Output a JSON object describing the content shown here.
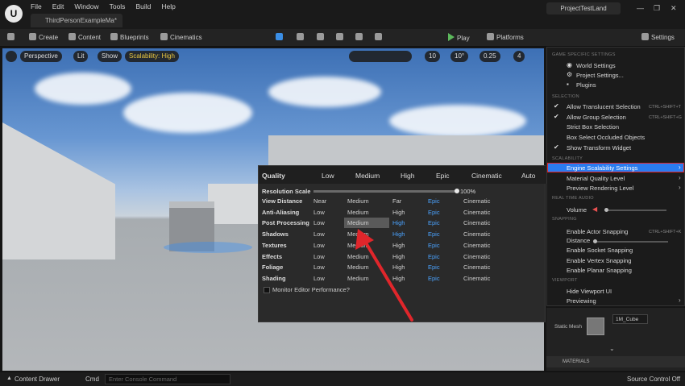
{
  "app": {
    "menus": [
      "File",
      "Edit",
      "Window",
      "Tools",
      "Build",
      "Help"
    ],
    "document_tab": "ThirdPersonExampleMa*",
    "project_name": "ProjectTestLand",
    "window_controls": [
      "—",
      "❐",
      "✕"
    ]
  },
  "toolbar": {
    "create": "Create",
    "content": "Content",
    "blueprints": "Blueprints",
    "cinematics": "Cinematics",
    "play": "Play",
    "platforms": "Platforms",
    "settings": "Settings"
  },
  "viewport": {
    "perspective": "Perspective",
    "lit": "Lit",
    "show": "Show",
    "scalability": "Scalability: High",
    "grid_size": "10",
    "rotation_snap": "10°",
    "scale_snap": "0.25",
    "camera_speed": "4"
  },
  "scalability_panel": {
    "quality_label": "Quality",
    "levels": [
      "Low",
      "Medium",
      "High",
      "Epic",
      "Cinematic",
      "Auto"
    ],
    "resolution_label": "Resolution Scale",
    "resolution_value": "100%",
    "resolution_fraction": 1.0,
    "rows": [
      {
        "label": "View Distance",
        "cells": [
          "Near",
          "Medium",
          "Far",
          "Epic",
          "Cinematic"
        ]
      },
      {
        "label": "Anti-Aliasing",
        "cells": [
          "Low",
          "Medium",
          "High",
          "Epic",
          "Cinematic"
        ]
      },
      {
        "label": "Post Processing",
        "cells": [
          "Low",
          "Medium",
          "High",
          "Epic",
          "Cinematic"
        ]
      },
      {
        "label": "Shadows",
        "cells": [
          "Low",
          "Medium",
          "High",
          "Epic",
          "Cinematic"
        ]
      },
      {
        "label": "Textures",
        "cells": [
          "Low",
          "Medium",
          "High",
          "Epic",
          "Cinematic"
        ]
      },
      {
        "label": "Effects",
        "cells": [
          "Low",
          "Medium",
          "High",
          "Epic",
          "Cinematic"
        ]
      },
      {
        "label": "Foliage",
        "cells": [
          "Low",
          "Medium",
          "High",
          "Epic",
          "Cinematic"
        ]
      },
      {
        "label": "Shading",
        "cells": [
          "Low",
          "Medium",
          "High",
          "Epic",
          "Cinematic"
        ]
      }
    ],
    "monitor_label": "Monitor Editor Performance?"
  },
  "settings_menu": {
    "sections": {
      "game_specific": "GAME SPECIFIC SETTINGS",
      "selection": "SELECTION",
      "scalability": "SCALABILITY",
      "realtime_audio": "REAL TIME AUDIO",
      "snapping": "SNAPPING",
      "viewport": "VIEWPORT"
    },
    "world_settings": "World Settings",
    "project_settings": "Project Settings...",
    "plugins": "Plugins",
    "allow_translucent": "Allow Translucent Selection",
    "allow_translucent_shortcut": "CTRL+SHIFT+T",
    "allow_group": "Allow Group Selection",
    "allow_group_shortcut": "CTRL+SHIFT+G",
    "strict_box": "Strict Box Selection",
    "box_occluded": "Box Select Occluded Objects",
    "show_transform": "Show Transform Widget",
    "engine_scalability": "Engine Scalability Settings",
    "material_quality": "Material Quality Level",
    "preview_rendering": "Preview Rendering Level",
    "volume": "Volume",
    "enable_actor_snapping": "Enable Actor Snapping",
    "actor_snapping_shortcut": "CTRL+SHIFT+K",
    "distance": "Distance",
    "enable_socket": "Enable Socket Snapping",
    "enable_vertex": "Enable Vertex Snapping",
    "enable_planar": "Enable Planar Snapping",
    "hide_viewport_ui": "Hide Viewport UI",
    "previewing": "Previewing"
  },
  "details": {
    "static_mesh_label": "Static Mesh",
    "mesh_asset": "1M_Cube",
    "materials_label": "MATERIALS"
  },
  "statusbar": {
    "content_drawer": "Content Drawer",
    "cmd": "Cmd",
    "console_placeholder": "Enter Console Command",
    "source_control": "Source Control Off"
  },
  "colors": {
    "highlight_blue": "#2a7cf0",
    "annotation_red": "#e0262b",
    "scalability_yellow": "#e8c640",
    "link_blue": "#4aa3ff"
  }
}
